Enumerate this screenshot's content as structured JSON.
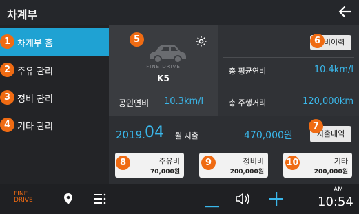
{
  "app_title": "차계부",
  "sidebar": {
    "items": [
      {
        "badge": "1",
        "label": "차계부 홈"
      },
      {
        "badge": "2",
        "label": "주유 관리"
      },
      {
        "badge": "3",
        "label": "정비 관리"
      },
      {
        "badge": "4",
        "label": "기타 관리"
      }
    ]
  },
  "car": {
    "badge": "5",
    "brand": "FINE DRIVE",
    "model": "K5",
    "official_label": "공인연비",
    "official_value": "10.3km/l"
  },
  "stats": {
    "history_badge": "6",
    "history_button": "정비이력",
    "avg_label": "총 평균연비",
    "avg_value": "10.4km/l",
    "distance_label": "총 주행거리",
    "distance_value": "120,000km"
  },
  "expense": {
    "year": "2019.",
    "month": "04",
    "suffix": "월 지출",
    "total": "470,000원",
    "details_badge": "7",
    "details_button": "지출내역"
  },
  "categories": [
    {
      "badge": "8",
      "name": "주유비",
      "amount": "70,000원"
    },
    {
      "badge": "9",
      "name": "정비비",
      "amount": "200,000원"
    },
    {
      "badge": "10",
      "name": "기타",
      "amount": "200,000원"
    }
  ],
  "bottom": {
    "logo_top": "FINE",
    "logo_bottom": "DRIVE",
    "ampm": "AM",
    "time": "10:54"
  },
  "colors": {
    "accent": "#1fa2d3",
    "highlight": "#3ab7ea",
    "badge": "#ef6b13"
  }
}
